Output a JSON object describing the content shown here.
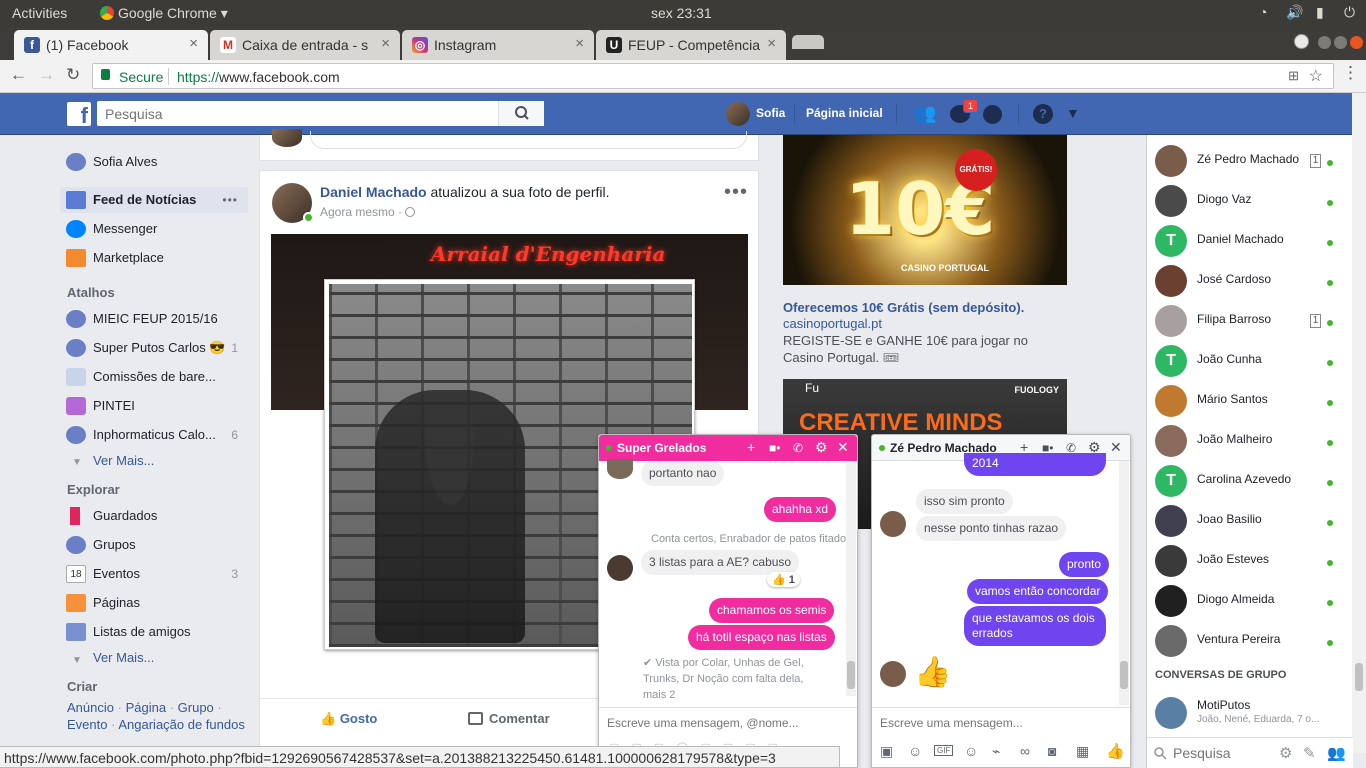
{
  "os": {
    "activities": "Activities",
    "app": "Google Chrome ▾",
    "clock": "sex 23:31"
  },
  "tabs": [
    {
      "label": "(1) Facebook",
      "icon": "facebook-icon",
      "color": "#3b5998"
    },
    {
      "label": "Caixa de entrada - s",
      "icon": "gmail-icon",
      "color": "#d93025"
    },
    {
      "label": "Instagram",
      "icon": "instagram-icon",
      "color": "#c13584"
    },
    {
      "label": "FEUP - Competência",
      "icon": "feup-icon",
      "color": "#222222"
    }
  ],
  "omnibox": {
    "secure": "Secure",
    "scheme": "https://",
    "host": "www.facebook.com"
  },
  "fb": {
    "search_placeholder": "Pesquisa",
    "profile_name": "Sofia",
    "home": "Página inicial",
    "messenger_badge": "1"
  },
  "leftnav": {
    "profile": "Sofia Alves",
    "main": [
      {
        "label": "Feed de Notícias",
        "more": "•••"
      },
      {
        "label": "Messenger"
      },
      {
        "label": "Marketplace"
      }
    ],
    "shortcuts_head": "Atalhos",
    "shortcuts": [
      {
        "label": "MIEIC FEUP 2015/16",
        "count": ""
      },
      {
        "label": "Super Putos Carlos 😎",
        "count": "1"
      },
      {
        "label": "Comissões de bare...",
        "count": ""
      },
      {
        "label": "PINTEI",
        "count": ""
      },
      {
        "label": "Inphormaticus Calo...",
        "count": "6"
      }
    ],
    "more": "Ver Mais...",
    "explore_head": "Explorar",
    "explore": [
      {
        "label": "Guardados",
        "count": ""
      },
      {
        "label": "Grupos",
        "count": ""
      },
      {
        "label": "Eventos",
        "count": "3"
      },
      {
        "label": "Páginas",
        "count": ""
      },
      {
        "label": "Listas de amigos",
        "count": ""
      }
    ],
    "more2": "Ver Mais...",
    "create_head": "Criar",
    "create_links": [
      "Anúncio",
      "Página",
      "Grupo",
      "Evento",
      "Angariação de fundos"
    ],
    "create_sep": "·"
  },
  "post": {
    "author": "Daniel Machado",
    "action": " atualizou a sua foto de perfil.",
    "time": "Agora mesmo · ",
    "banner_title": "Arraial d'Engenharia",
    "like": "Gosto",
    "comment": "Comentar"
  },
  "ads": {
    "ad1": {
      "big": "10€",
      "badge": "GRÁTIS!",
      "brand_img": "CASINO PORTUGAL",
      "title": "Oferecemos 10€ Grátis (sem depósito).",
      "link": "casinoportugal.pt",
      "text": "REGISTE-SE e GANHE 10€ para jogar no Casino Portugal. 🎟"
    },
    "ad2": {
      "headline": "CREATIVE MINDS",
      "brand": "FUOLOGY",
      "logo": "Fu"
    }
  },
  "contacts": [
    {
      "name": "Zé Pedro Machado",
      "unread": "1",
      "color": "#7a5c4a"
    },
    {
      "name": "Diogo Vaz",
      "unread": "",
      "color": "#4a4a4a"
    },
    {
      "name": "Daniel Machado",
      "unread": "",
      "color": "#2fb863",
      "letter": "T"
    },
    {
      "name": "José Cardoso",
      "unread": "",
      "color": "#6a4030"
    },
    {
      "name": "Filipa Barroso",
      "unread": "1",
      "color": "#a8a0a0"
    },
    {
      "name": "João Cunha",
      "unread": "",
      "color": "#2fb863",
      "letter": "T"
    },
    {
      "name": "Mário Santos",
      "unread": "",
      "color": "#c07a30"
    },
    {
      "name": "João Malheiro",
      "unread": "",
      "color": "#8a6a5a"
    },
    {
      "name": "Carolina Azevedo",
      "unread": "",
      "color": "#2fb863",
      "letter": "T"
    },
    {
      "name": "Joao Basilio",
      "unread": "",
      "color": "#404050"
    },
    {
      "name": "João Esteves",
      "unread": "",
      "color": "#3a3a3a"
    },
    {
      "name": "Diogo Almeida",
      "unread": "",
      "color": "#202020"
    },
    {
      "name": "Ventura Pereira",
      "unread": "",
      "color": "#6a6a6a"
    }
  ],
  "group_chats_head": "CONVERSAS DE GRUPO",
  "group_chat": {
    "name": "MotiPutos",
    "members": "João, Nené, Eduarda, 7 o..."
  },
  "chat_search": "Pesquisa",
  "chat1": {
    "title": "Super Grelados",
    "accent": "#f02c9f",
    "messages": [
      {
        "text": "portanto nao",
        "dir": "in"
      },
      {
        "text": "ahahha xd",
        "dir": "out"
      },
      {
        "text": "Conta certos, Enrabador de patos fitado",
        "dir": "meta"
      },
      {
        "text": "3 listas para a AE? cabuso",
        "dir": "in"
      },
      {
        "text": "👍 1",
        "dir": "reaction"
      },
      {
        "text": "chamamos os semis",
        "dir": "out"
      },
      {
        "text": "há totil espaço nas listas",
        "dir": "out"
      },
      {
        "text": "✔ Vista por Colar, Unhas de Gel, Trunks, Dr Noção com falta dela, mais 2",
        "dir": "seen"
      }
    ],
    "composer": "Escreve uma mensagem, @nome..."
  },
  "chat2": {
    "title": "Zé Pedro Machado",
    "accent": "#6f45f0",
    "messages": [
      {
        "text": "2014",
        "dir": "out"
      },
      {
        "text": "isso sim pronto",
        "dir": "in"
      },
      {
        "text": "nesse ponto tinhas razao",
        "dir": "in"
      },
      {
        "text": "pronto",
        "dir": "out"
      },
      {
        "text": "vamos então concordar",
        "dir": "out"
      },
      {
        "text": "que estavamos os dois errados",
        "dir": "out"
      }
    ],
    "composer": "Escreve uma mensagem..."
  },
  "statusbar": "https://www.facebook.com/photo.php?fbid=1292690567428537&set=a.201388213225450.61481.100000628179578&type=3"
}
